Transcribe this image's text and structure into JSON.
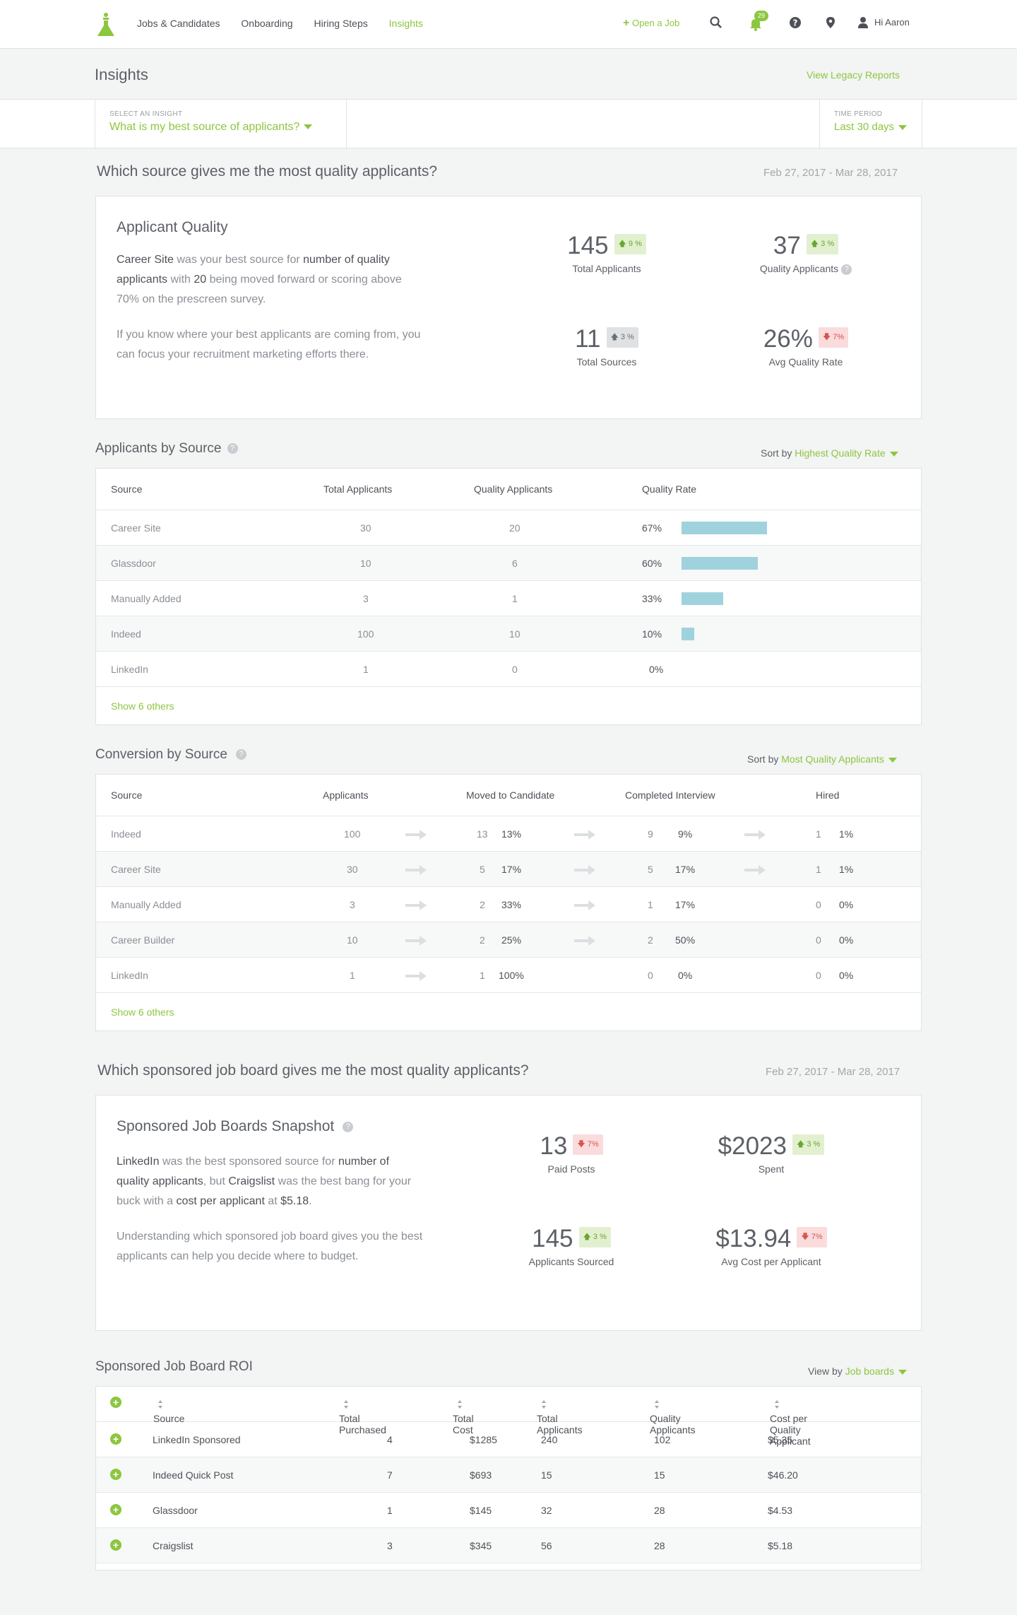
{
  "nav": {
    "items": [
      "Jobs & Candidates",
      "Onboarding",
      "Hiring Steps",
      "Insights"
    ],
    "open_job": "Open a Job",
    "notifications": "29",
    "greeting": "Hi Aaron"
  },
  "page": {
    "title": "Insights",
    "legacy_link": "View Legacy Reports",
    "insight_label": "SELECT AN INSIGHT",
    "insight_value": "What is my best source of applicants?",
    "period_label": "TIME PERIOD",
    "period_value": "Last 30 days"
  },
  "quality": {
    "question": "Which source gives me the most quality applicants?",
    "date_range": "Feb 27, 2017 - Mar 28, 2017",
    "card_title": "Applicant Quality",
    "summary_1": "Career Site was your best source for number of quality applicants with 20 being moved forward or scoring above 70% on the prescreen survey.",
    "summary_2": "If you know where your best applicants are coming from, you can focus your recruitment marketing efforts there.",
    "stats": [
      {
        "value": "145",
        "delta": "9 %",
        "label": "Total Applicants"
      },
      {
        "value": "37",
        "delta": "3 %",
        "label": "Quality Applicants"
      },
      {
        "value": "11",
        "delta": "3 %",
        "label": "Total Sources"
      },
      {
        "value": "26%",
        "delta": "7%",
        "label": "Avg Quality Rate"
      }
    ]
  },
  "by_source": {
    "title": "Applicants by Source",
    "sort_label": "Sort by",
    "sort_value": "Highest Quality Rate",
    "headers": [
      "Source",
      "Total Applicants",
      "Quality Applicants",
      "Quality Rate"
    ],
    "rows": [
      {
        "source": "Career Site",
        "total": "30",
        "quality": "20",
        "rate": "67%",
        "rate_value": 0.67
      },
      {
        "source": "Glassdoor",
        "total": "10",
        "quality": "6",
        "rate": "60%",
        "rate_value": 0.6
      },
      {
        "source": "Manually Added",
        "total": "3",
        "quality": "1",
        "rate": "33%",
        "rate_value": 0.33
      },
      {
        "source": "Indeed",
        "total": "100",
        "quality": "10",
        "rate": "10%",
        "rate_value": 0.1
      },
      {
        "source": "LinkedIn",
        "total": "1",
        "quality": "0",
        "rate": "0%",
        "rate_value": 0
      }
    ],
    "show_more": "Show 6 others"
  },
  "conversion": {
    "title": "Conversion by Source",
    "sort_label": "Sort by",
    "sort_value": "Most Quality Applicants",
    "headers": [
      "Source",
      "Applicants",
      "Moved to Candidate",
      "Completed Interview",
      "Hired"
    ],
    "rows": [
      {
        "source": "Indeed",
        "applicants": "100",
        "moved": "13",
        "moved_pct": "13%",
        "interview": "9",
        "interview_pct": "9%",
        "hired": "1",
        "hired_pct": "1%"
      },
      {
        "source": "Career Site",
        "applicants": "30",
        "moved": "5",
        "moved_pct": "17%",
        "interview": "5",
        "interview_pct": "17%",
        "hired": "1",
        "hired_pct": "1%"
      },
      {
        "source": "Manually Added",
        "applicants": "3",
        "moved": "2",
        "moved_pct": "33%",
        "interview": "1",
        "interview_pct": "17%",
        "hired": "0",
        "hired_pct": "0%"
      },
      {
        "source": "Career Builder",
        "applicants": "10",
        "moved": "2",
        "moved_pct": "25%",
        "interview": "2",
        "interview_pct": "50%",
        "hired": "0",
        "hired_pct": "0%"
      },
      {
        "source": "LinkedIn",
        "applicants": "1",
        "moved": "1",
        "moved_pct": "100%",
        "interview": "0",
        "interview_pct": "0%",
        "hired": "0",
        "hired_pct": "0%"
      }
    ],
    "show_more": "Show 6 others"
  },
  "sponsored": {
    "question": "Which sponsored job board gives me the most quality applicants?",
    "date_range": "Feb 27, 2017 - Mar 28, 2017",
    "card_title": "Sponsored Job Boards Snapshot",
    "summary_1": "LinkedIn was the best sponsored source for number of quality applicants, but Craigslist was the best bang for your buck with a cost per applicant at $5.18.",
    "summary_2": "Understanding which sponsored job board gives you the best applicants can help you decide where to budget.",
    "stats": [
      {
        "value": "13",
        "delta": "7%",
        "label": "Paid Posts"
      },
      {
        "value": "$2023",
        "delta": "3 %",
        "label": "Spent"
      },
      {
        "value": "145",
        "delta": "3 %",
        "label": "Applicants Sourced"
      },
      {
        "value": "$13.94",
        "delta": "7%",
        "label": "Avg Cost per Applicant"
      }
    ]
  },
  "roi": {
    "title": "Sponsored Job Board ROI",
    "view_label": "View by",
    "view_value": "Job boards",
    "headers": [
      "Source",
      "Total Purchased",
      "Total Cost",
      "Total Applicants",
      "Quality Applicants",
      "Cost per Quality Applicant"
    ],
    "rows": [
      {
        "source": "LinkedIn Sponsored",
        "purchased": "4",
        "cost": "$1285",
        "applicants": "240",
        "quality": "102",
        "cpqa": "$5.35"
      },
      {
        "source": "Indeed Quick Post",
        "purchased": "7",
        "cost": "$693",
        "applicants": "15",
        "quality": "15",
        "cpqa": "$46.20"
      },
      {
        "source": "Glassdoor",
        "purchased": "1",
        "cost": "$145",
        "applicants": "32",
        "quality": "28",
        "cpqa": "$4.53"
      },
      {
        "source": "Craigslist",
        "purchased": "3",
        "cost": "$345",
        "applicants": "56",
        "quality": "28",
        "cpqa": "$5.18"
      }
    ]
  }
}
